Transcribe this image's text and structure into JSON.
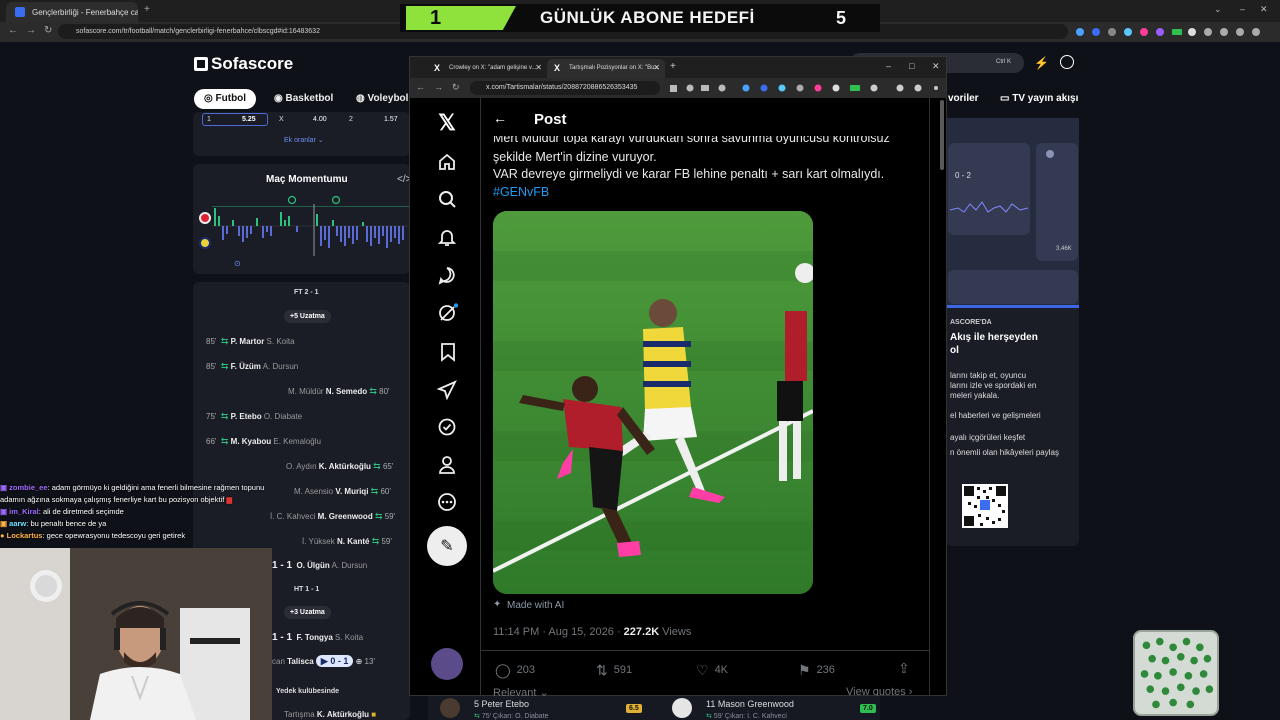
{
  "outer_browser": {
    "tab_title": "Gençlerbirliği - Fenerbahçe canlı",
    "url": "sofascore.com/tr/football/match/genclerbirligi-fenerbahce/clbscgd#id:16483632"
  },
  "goal_banner": {
    "current": "1",
    "title": "GÜNLÜK ABONE HEDEFİ",
    "target": "5"
  },
  "sofascore": {
    "logo": "Sofascore",
    "tabs": [
      "Futbol",
      "Basketbol",
      "Voleybol"
    ],
    "search_shortcut": "Ctrl K",
    "right_nav": [
      "voriler",
      "TV yayın akışı"
    ],
    "odds": {
      "c1": "1",
      "v1": "5.25",
      "cx": "X",
      "vx": "4.00",
      "c2": "2",
      "v2": "1.57",
      "more": "Ek oranlar"
    },
    "momentum_title": "Maç Momentumu",
    "momentum_code_icon": "</>",
    "events": {
      "ft_label": "FT 2 - 1",
      "extra1": "+5 Uzatma",
      "rows": [
        {
          "min": "85'",
          "main": "P. Martor",
          "sub": "S. Koita"
        },
        {
          "min": "85'",
          "main": "F. Üzüm",
          "sub": "A. Dursun"
        },
        {
          "min": "80'",
          "sub": "M. Müldür",
          "main": "N. Semedo"
        },
        {
          "min": "75'",
          "main": "P. Etebo",
          "sub": "O. Diabate"
        },
        {
          "min": "66'",
          "main": "M. Kyabou",
          "sub": "E. Kemaloğlu"
        },
        {
          "min": "65'",
          "sub": "O. Aydın",
          "main": "K. Aktürkoğlu"
        },
        {
          "min": "60'",
          "sub": "M. Asensio",
          "main": "V. Muriqi"
        },
        {
          "min": "59'",
          "sub": "İ. C. Kahveci",
          "main": "M. Greenwood"
        },
        {
          "min": "59'",
          "sub": "İ. Yüksek",
          "main": "N. Kanté"
        },
        {
          "score": "1 - 1",
          "main": "O. Ülgün",
          "sub": "A. Dursun"
        }
      ],
      "ht_label": "HT 1 - 1",
      "extra2": "+3 Uzatma",
      "rows2": [
        {
          "score": "1 - 1",
          "main": "F. Tongya",
          "sub": "S. Koita"
        },
        {
          "pre": "can",
          "main": "Talisca",
          "score": "0 - 1",
          "min": "13'"
        }
      ],
      "bench_label": "Yedek kulübesinde",
      "bench_row": {
        "sub": "Tartışma",
        "main": "K. Aktürkoğlu"
      }
    },
    "promo": {
      "small": "ASCORE'DA",
      "heading": "Akış ile herşeyden",
      "heading2": "ol",
      "mock_score": "0 - 2",
      "mock_stat": "3,46K",
      "lines": [
        "larını takip et, oyuncu",
        "larını izle ve spordaki en",
        "meleri yakala.",
        "el haberleri ve gelişmeleri",
        "ayalı içgörüleri keşfet",
        "n önemli olan hikâyeleri paylaş"
      ]
    },
    "bottom_players": [
      {
        "name": "5 Peter Etebo",
        "sub": "75' Çıkan: O. Diabate",
        "rating": "6.5",
        "rating_color": "#e0b234"
      },
      {
        "name": "11 Mason Greenwood",
        "sub": "59' Çıkan: İ. C. Kahveci",
        "rating": "7.0",
        "rating_color": "#2fbf4f"
      }
    ]
  },
  "x_window": {
    "tabs": [
      {
        "title": "Crowley on X: \"adam gelişine v..."
      },
      {
        "title": "Tartışmalı Pozisyonlar on X: \"Bu..."
      }
    ],
    "url": "x.com/Tartismalar/status/2088720886526353435",
    "post": {
      "header": "Post",
      "line0": "Mert Müldür topa karayı vurduktan sonra savunma oyuncusu kontrolsüz",
      "line1": "şekilde Mert'in dizine vuruyor.",
      "line2": "VAR devreye girmeliydi ve karar FB lehine penaltı + sarı kart olmalıydı.",
      "hashtag": "#GENvFB",
      "made_with_ai": "Made with AI",
      "time": "11:14 PM · Aug 15, 2026 · ",
      "views_count": "227.2K",
      "views_label": " Views",
      "replies": "203",
      "reposts": "591",
      "likes": "4K",
      "bookmarks": "236",
      "relevant": "Relevant",
      "view_quotes": "View quotes"
    }
  },
  "chat": [
    {
      "user": "zombie_ee",
      "msg": ": adam görmüyo ki geldiğini ama fenerli bilmesine rağmen topunu"
    },
    {
      "user": "",
      "msg": "adamın ağzına sokmaya çalışmış fenerliye kart bu pozisyon objektif"
    },
    {
      "user": "im_Kiral",
      "msg": ": ali de diretmedi seçimde"
    },
    {
      "user": "aarw",
      "msg": ": bu penaltı bence de ya"
    },
    {
      "user": "Lockartus",
      "msg": ": gece opewrasyonu tedescoyu geri getirek"
    }
  ]
}
